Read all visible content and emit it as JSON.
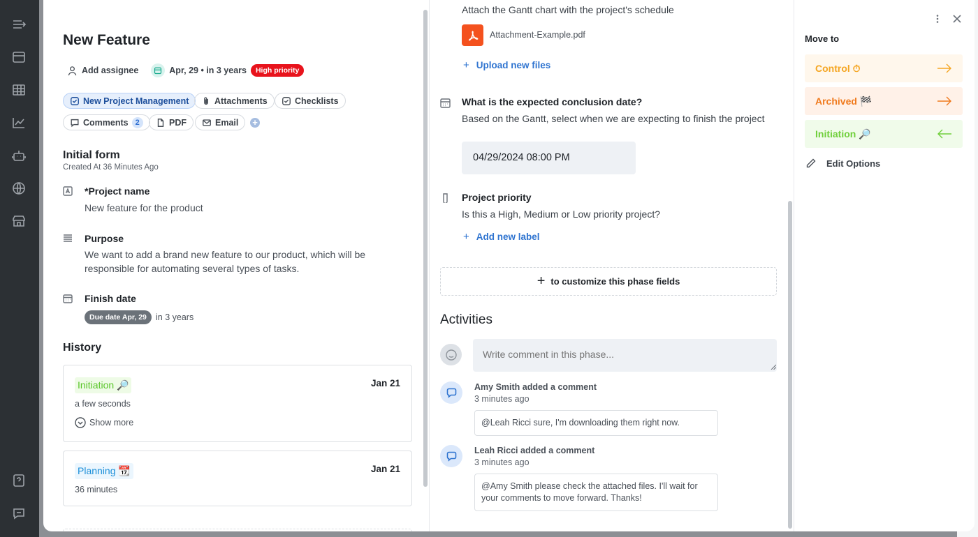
{
  "card": {
    "title": "New Feature",
    "add_assignee": "Add assignee",
    "due": "Apr, 29 • in 3 years",
    "priority_badge": "High priority"
  },
  "chips": {
    "pipe": "New Project Management",
    "attachments": "Attachments",
    "checklists": "Checklists",
    "comments": "Comments",
    "comments_count": "2",
    "pdf": "PDF",
    "email": "Email"
  },
  "form": {
    "title": "Initial form",
    "subtitle": "Created At 36 Minutes Ago",
    "fields": [
      {
        "label": "*Project name",
        "value": "New feature for the product"
      },
      {
        "label": "Purpose",
        "value": "We want to add a brand new feature to our product, which will be responsible for automating several types of tasks."
      },
      {
        "label": "Finish date",
        "due_chip": "Due date Apr, 29",
        "relative": "in 3 years"
      }
    ]
  },
  "history": {
    "title": "History",
    "items": [
      {
        "phase": "Initiation 🔎",
        "date": "Jan 21",
        "sub": "a few seconds",
        "show_more": "Show more"
      },
      {
        "phase": "Planning 📆",
        "date": "Jan 21",
        "sub": "36 minutes"
      }
    ]
  },
  "phase": {
    "attach_desc": "Attach the Gantt chart with the project's schedule",
    "attachment_name": "Attachment-Example.pdf",
    "upload": "Upload new files",
    "q_date_label": "What is the expected conclusion date?",
    "q_date_desc": "Based on the Gantt, select when we are expecting to finish the project",
    "q_date_value": "04/29/2024 08:00 PM",
    "q_priority_label": "Project priority",
    "q_priority_desc": "Is this a High, Medium or Low priority project?",
    "add_label": "Add new label",
    "customize": "to customize this phase fields"
  },
  "activities": {
    "title": "Activities",
    "placeholder": "Write comment in this phase...",
    "comments": [
      {
        "author": "Amy Smith added a comment",
        "time": "3 minutes ago",
        "text": "@Leah Ricci sure, I'm downloading them right now."
      },
      {
        "author": "Leah Ricci added a comment",
        "time": "3 minutes ago",
        "text": "@Amy Smith please check the attached files. I'll wait for your comments to move forward. Thanks!"
      }
    ]
  },
  "move": {
    "title": "Move to",
    "options": [
      {
        "label": "Control ⏱",
        "color": "#f5a623",
        "bg": "#fff7ec"
      },
      {
        "label": "Archived 🏁",
        "color": "#f07a1d",
        "bg": "#fff1e8"
      },
      {
        "label": "Initiation 🔎",
        "color": "#6fcf3a",
        "bg": "#f0fbea"
      }
    ],
    "edit_options": "Edit Options"
  },
  "colors": {
    "accent_blue": "#2f74d0",
    "danger": "#e8131c",
    "sidebar": "#2c3034"
  }
}
